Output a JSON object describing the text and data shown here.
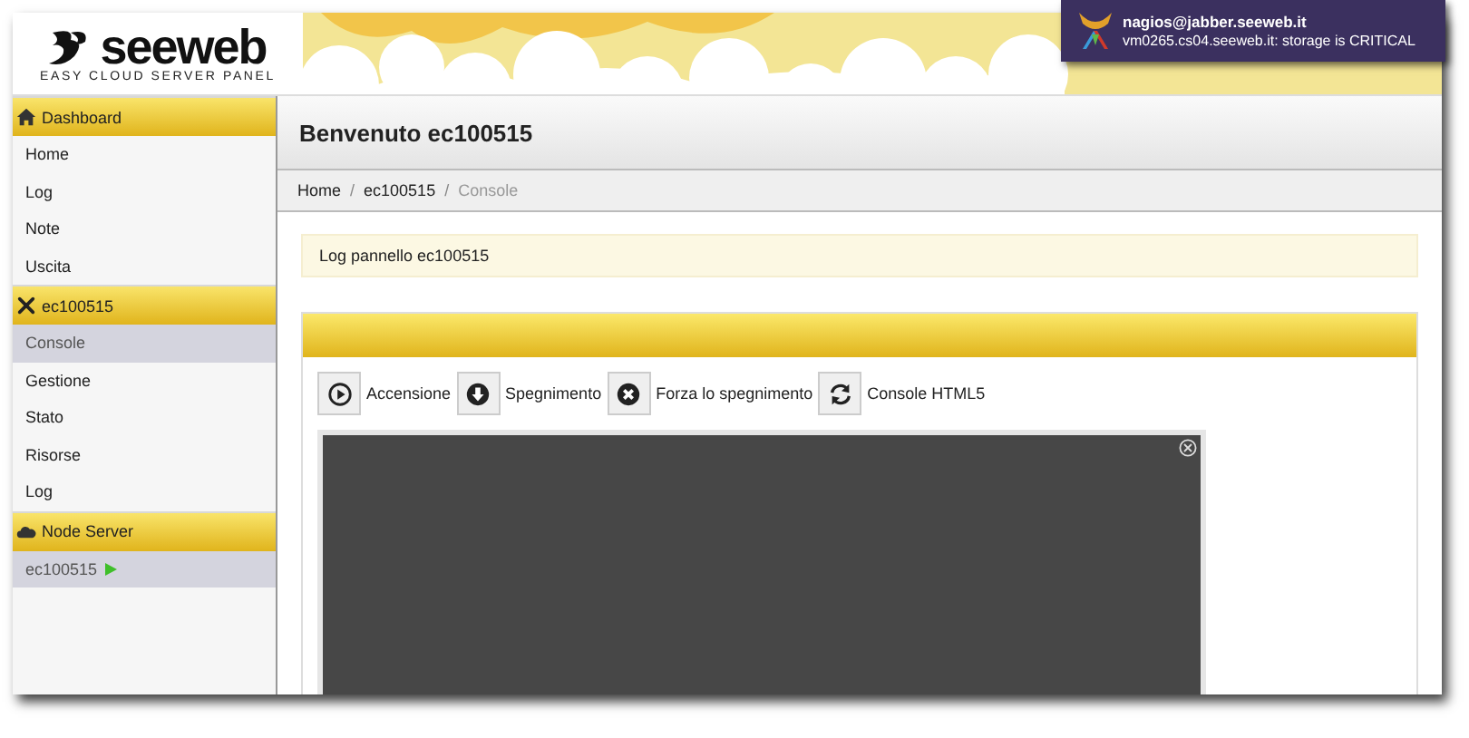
{
  "header": {
    "logo": {
      "name": "seeweb",
      "tagline": "EASY CLOUD SERVER PANEL"
    }
  },
  "notification": {
    "title": "nagios@jabber.seeweb.it",
    "message": "vm0265.cs04.seeweb.it: storage is CRITICAL"
  },
  "sidebar": {
    "sections": [
      {
        "title": "Dashboard",
        "items": [
          {
            "label": "Home",
            "selected": false
          },
          {
            "label": "Log",
            "selected": false
          },
          {
            "label": "Note",
            "selected": false
          },
          {
            "label": "Uscita",
            "selected": false
          }
        ]
      },
      {
        "title": "ec100515",
        "items": [
          {
            "label": "Console",
            "selected": true
          },
          {
            "label": "Gestione",
            "selected": false
          },
          {
            "label": "Stato",
            "selected": false
          },
          {
            "label": "Risorse",
            "selected": false
          },
          {
            "label": "Log",
            "selected": false
          }
        ]
      },
      {
        "title": "Node Server",
        "items": [
          {
            "label": "ec100515",
            "selected": true,
            "running": true
          }
        ]
      }
    ]
  },
  "page": {
    "title": "Benvenuto ec100515",
    "breadcrumb": [
      {
        "label": "Home",
        "current": false
      },
      {
        "separator": "/",
        "label": "ec100515",
        "current": false
      },
      {
        "separator": "/",
        "label": "Console",
        "current": true
      }
    ],
    "alert": "Log pannello ec100515",
    "actions": [
      {
        "label": "Accensione"
      },
      {
        "label": "Spegnimento"
      },
      {
        "label": "Forza lo spegnimento"
      },
      {
        "label": "Console HTML5"
      }
    ]
  }
}
